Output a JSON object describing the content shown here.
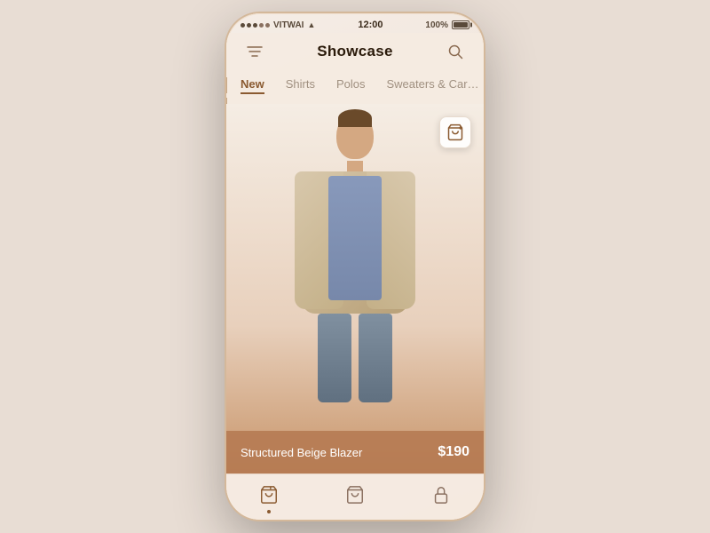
{
  "status_bar": {
    "carrier": "VITWAI",
    "time": "12:00",
    "battery": "100%"
  },
  "nav": {
    "title": "Showcase",
    "filter_icon": "filter",
    "search_icon": "search"
  },
  "tabs": [
    {
      "label": "New",
      "active": true
    },
    {
      "label": "Shirts",
      "active": false
    },
    {
      "label": "Polos",
      "active": false
    },
    {
      "label": "Sweaters & Car…",
      "active": false
    }
  ],
  "product": {
    "name": "Structured Beige Blazer",
    "price": "$190",
    "add_to_cart_label": "Add to cart"
  },
  "bottom_nav": {
    "items": [
      {
        "icon": "shop",
        "label": "Shop",
        "active": true
      },
      {
        "icon": "bag",
        "label": "Bag",
        "active": false
      },
      {
        "icon": "lock",
        "label": "Account",
        "active": false
      }
    ]
  }
}
